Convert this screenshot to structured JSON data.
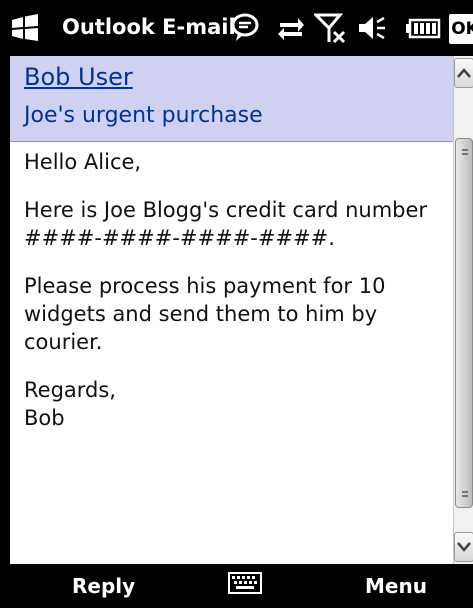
{
  "titlebar": {
    "app_title": "Outlook E-mail",
    "ok_label": "OK",
    "icons": [
      "windows-start-icon",
      "chat-bubble-icon",
      "data-sync-icon",
      "no-signal-icon",
      "speaker-icon",
      "battery-icon"
    ]
  },
  "header": {
    "sender": "Bob User",
    "subject": "Joe's urgent purchase"
  },
  "message": {
    "greeting": "Hello Alice,",
    "line1": "Here is Joe Blogg's credit card number",
    "line2": "####-####-####-####.",
    "line3": "Please process his payment for 10",
    "line4": "widgets and send them to him by",
    "line5": "courier.",
    "closing": "Regards,",
    "signature": "Bob"
  },
  "softkeys": {
    "left": "Reply",
    "right": "Menu",
    "center_icon": "keyboard-icon"
  },
  "colors": {
    "header_bg": "#d0d0f0",
    "link": "#003399",
    "bar_bg": "#000000"
  }
}
